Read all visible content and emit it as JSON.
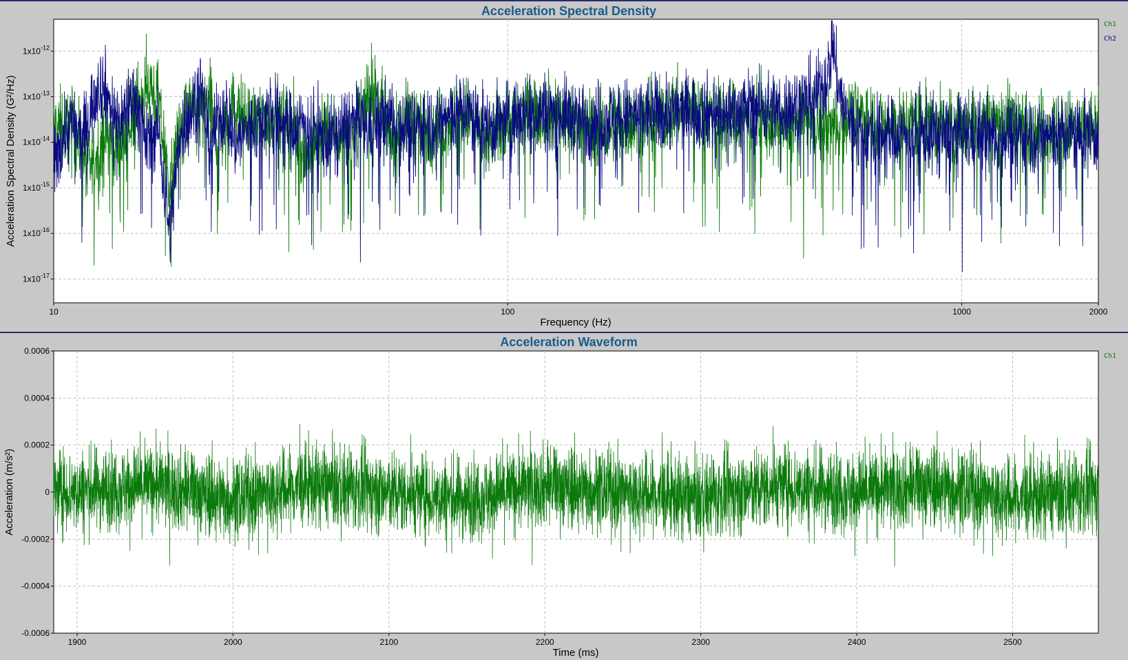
{
  "colors": {
    "ch1": "#0b7a0b",
    "ch2": "#0a0a80",
    "title": "#1a5a8a",
    "frame_bg": "#c8c8c8",
    "plot_bg": "#ffffff",
    "separator": "#2a2a6a"
  },
  "chart_data": [
    {
      "type": "line",
      "title": "Acceleration Spectral Density",
      "xlabel": "Frequency (Hz)",
      "ylabel": "Acceleration Spectral Density (G²/Hz)",
      "x_scale": "log",
      "y_scale": "log",
      "xlim": [
        10,
        2000
      ],
      "ylim": [
        3e-18,
        5e-12
      ],
      "x_ticks": [
        {
          "value": 10,
          "label": "10"
        },
        {
          "value": 100,
          "label": "100"
        },
        {
          "value": 1000,
          "label": "1000"
        },
        {
          "value": 2000,
          "label": "2000"
        }
      ],
      "x_gridlines": [
        10,
        100,
        1000
      ],
      "y_ticks": [
        {
          "value": 1e-12,
          "mantissa": "1x10",
          "exp": "-12"
        },
        {
          "value": 1e-13,
          "mantissa": "1x10",
          "exp": "-13"
        },
        {
          "value": 1e-14,
          "mantissa": "1x10",
          "exp": "-14"
        },
        {
          "value": 1e-15,
          "mantissa": "1x10",
          "exp": "-15"
        },
        {
          "value": 1e-16,
          "mantissa": "1x10",
          "exp": "-16"
        },
        {
          "value": 1e-17,
          "mantissa": "1x10",
          "exp": "-17"
        }
      ],
      "grid": true,
      "legend_position": "right-top",
      "series": [
        {
          "name": "Ch1",
          "color": "#0b7a0b",
          "x": [
            10,
            10.5,
            11,
            11.5,
            12,
            12.5,
            13,
            13.5,
            14,
            15,
            16,
            17,
            18,
            19,
            20,
            21,
            22,
            23,
            24,
            25,
            27,
            30,
            33,
            36,
            40,
            45,
            50,
            55,
            60,
            70,
            80,
            90,
            100,
            120,
            150,
            200,
            250,
            300,
            350,
            400,
            450,
            500,
            550,
            600,
            700,
            800,
            900,
            1000,
            1200,
            1500,
            1800,
            2000
          ],
          "values": [
            2e-14,
            2.2e-14,
            1.8e-14,
            8e-15,
            2.5e-15,
            6e-15,
            1.5e-14,
            1e-14,
            8e-15,
            5e-14,
            2e-13,
            8e-14,
            1e-15,
            2e-14,
            5e-14,
            3e-14,
            8e-14,
            1e-14,
            3e-14,
            6e-14,
            2e-14,
            4e-14,
            3e-14,
            5e-15,
            2e-14,
            1e-14,
            2e-13,
            1e-14,
            3e-14,
            2e-14,
            5e-14,
            1e-14,
            3e-14,
            5e-14,
            2e-14,
            3e-14,
            6e-14,
            3e-14,
            4e-14,
            2e-14,
            3e-14,
            2e-14,
            3e-14,
            4e-14,
            2e-14,
            3e-14,
            2e-14,
            2e-14,
            3e-14,
            2e-14,
            2e-14,
            2e-14
          ]
        },
        {
          "name": "Ch2",
          "color": "#0a0a80",
          "x": [
            10,
            10.5,
            11,
            11.5,
            12,
            12.5,
            13,
            13.5,
            14,
            15,
            16,
            17,
            18,
            19,
            20,
            21,
            22,
            23,
            24,
            25,
            27,
            30,
            33,
            36,
            40,
            45,
            50,
            55,
            60,
            70,
            80,
            90,
            100,
            120,
            150,
            200,
            250,
            300,
            350,
            400,
            450,
            480,
            500,
            510,
            520,
            530,
            550,
            600,
            700,
            800,
            900,
            1000,
            1200,
            1500,
            1800,
            2000
          ],
          "values": [
            3e-15,
            1.5e-14,
            3e-14,
            1e-14,
            4e-14,
            2e-13,
            1.5e-13,
            4e-14,
            3e-14,
            1.2e-13,
            1e-14,
            2e-14,
            1e-16,
            2e-14,
            4e-14,
            2e-13,
            1e-14,
            3e-14,
            5e-14,
            1e-14,
            2e-14,
            5e-14,
            2e-14,
            3e-14,
            1e-14,
            3e-14,
            2e-14,
            4e-14,
            2e-14,
            3e-14,
            5e-14,
            2e-14,
            3e-14,
            5e-14,
            3e-14,
            4e-14,
            5e-14,
            4e-14,
            6e-14,
            5e-14,
            8e-14,
            1.3e-13,
            2e-13,
            4e-13,
            2e-12,
            3e-13,
            5e-14,
            1.5e-14,
            1.5e-14,
            1.5e-14,
            1.5e-14,
            1.5e-14,
            1.5e-14,
            1.5e-14,
            1.5e-14,
            1.5e-14
          ]
        }
      ]
    },
    {
      "type": "line",
      "title": "Acceleration Waveform",
      "xlabel": "Time (ms)",
      "ylabel": "Acceleration (m/s²)",
      "xlim": [
        1885,
        2555
      ],
      "ylim": [
        -0.0006,
        0.0006
      ],
      "x_ticks": [
        {
          "value": 1900,
          "label": "1900"
        },
        {
          "value": 2000,
          "label": "2000"
        },
        {
          "value": 2100,
          "label": "2100"
        },
        {
          "value": 2200,
          "label": "2200"
        },
        {
          "value": 2300,
          "label": "2300"
        },
        {
          "value": 2400,
          "label": "2400"
        },
        {
          "value": 2500,
          "label": "2500"
        }
      ],
      "y_ticks": [
        {
          "value": 0.0006,
          "label": "0.0006"
        },
        {
          "value": 0.0004,
          "label": "0.0004"
        },
        {
          "value": 0.0002,
          "label": "0.0002"
        },
        {
          "value": 0,
          "label": "0"
        },
        {
          "value": -0.0002,
          "label": "-0.0002"
        },
        {
          "value": -0.0004,
          "label": "-0.0004"
        },
        {
          "value": -0.0006,
          "label": "-0.0006"
        }
      ],
      "grid": true,
      "legend_position": "right-top",
      "series": [
        {
          "name": "Ch1",
          "color": "#0b7a0b",
          "x": [
            1885,
            1950,
            2000,
            2050,
            2100,
            2150,
            2200,
            2250,
            2300,
            2350,
            2400,
            2450,
            2500,
            2555
          ],
          "values": [
            0,
            0.0001,
            -0.0001,
            0.0001,
            0,
            -0.0001,
            0.0001,
            0,
            -0.0001,
            0.0001,
            0,
            0.0001,
            -0.0001,
            0
          ],
          "amplitude_range": [
            -0.0004,
            0.00037
          ]
        }
      ]
    }
  ]
}
